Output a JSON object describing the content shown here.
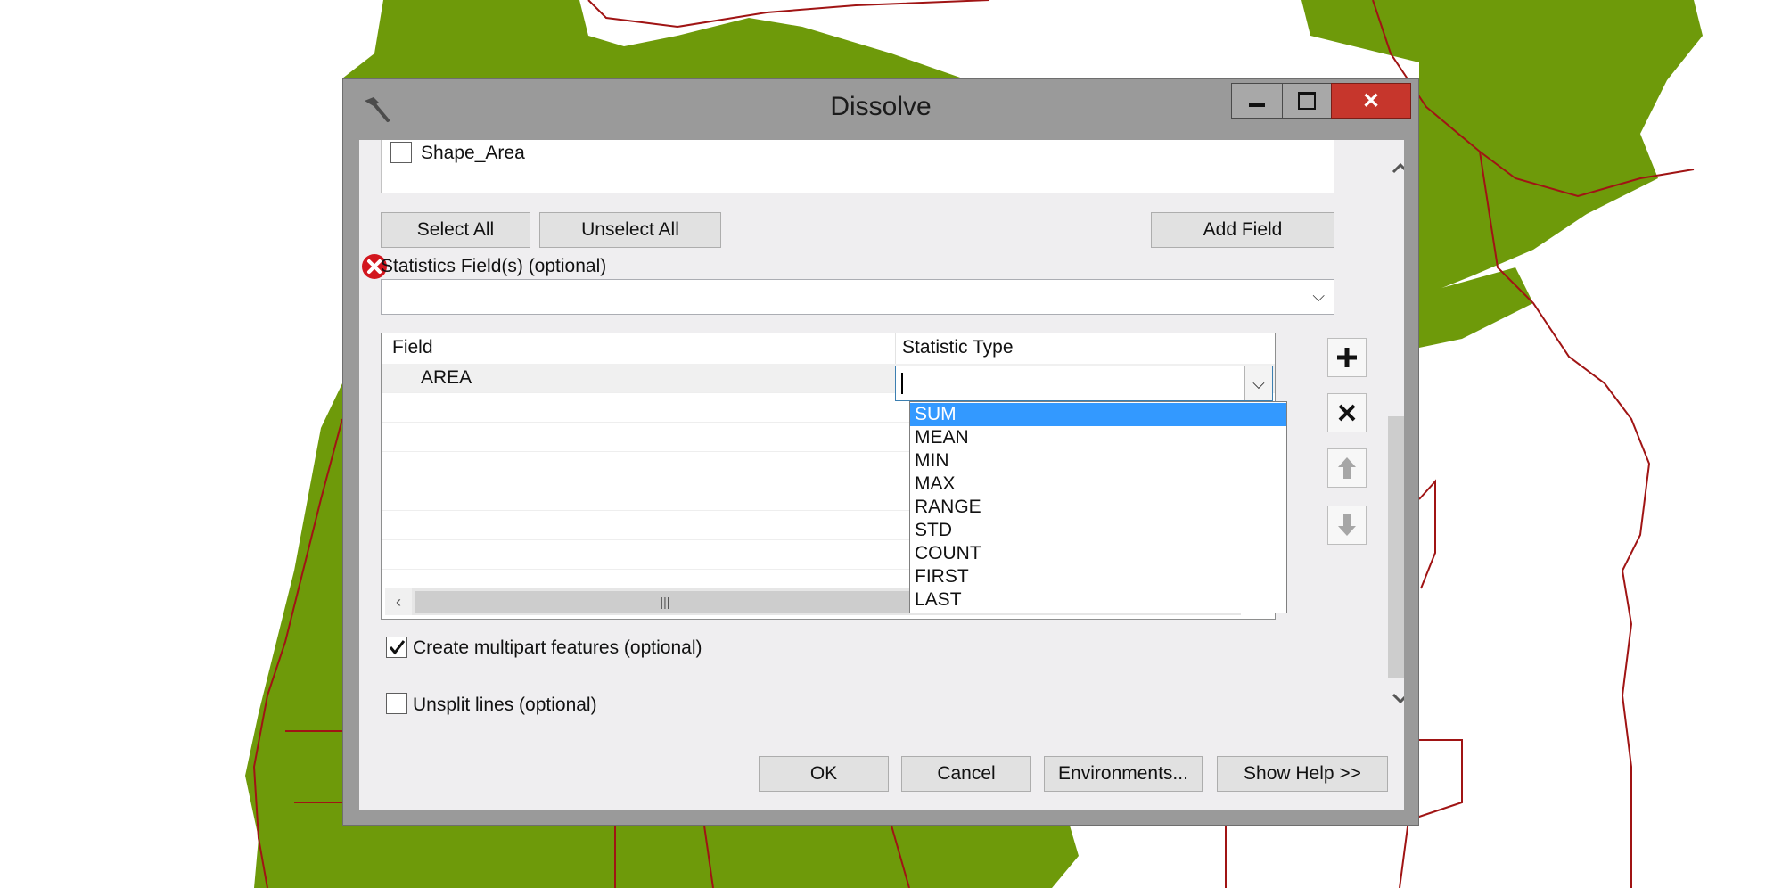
{
  "dialog": {
    "title": "Dissolve",
    "title_icon": "hammer-icon",
    "window_buttons": {
      "minimize_icon": "minimize-icon",
      "maximize_icon": "maximize-icon",
      "close_icon": "close-icon"
    }
  },
  "dissolve_fields": {
    "visible_item": "Shape_Area",
    "buttons": {
      "select_all": "Select All",
      "unselect_all": "Unselect All",
      "add_field": "Add Field"
    }
  },
  "statistics": {
    "label": "Statistics Field(s) (optional)",
    "error_icon": "error-icon",
    "combo_value": "",
    "columns": [
      "Field",
      "Statistic Type"
    ],
    "rows": [
      {
        "field": "AREA",
        "statistic_type": ""
      }
    ],
    "statistic_type_options": [
      "SUM",
      "MEAN",
      "MIN",
      "MAX",
      "RANGE",
      "STD",
      "COUNT",
      "FIRST",
      "LAST"
    ],
    "highlighted_option": "SUM",
    "side_buttons": [
      "add-icon",
      "remove-icon",
      "move-up-icon",
      "move-down-icon"
    ]
  },
  "options": {
    "multipart": {
      "label": "Create multipart features (optional)",
      "checked": true
    },
    "unsplit": {
      "label": "Unsplit lines (optional)",
      "checked": false
    }
  },
  "footer": {
    "ok": "OK",
    "cancel": "Cancel",
    "environments": "Environments...",
    "show_help": "Show Help >>"
  },
  "colors": {
    "vegetation": "#6e9a0a",
    "boundary": "#a01414",
    "selection": "#3399ff",
    "close_button": "#c6362c"
  }
}
